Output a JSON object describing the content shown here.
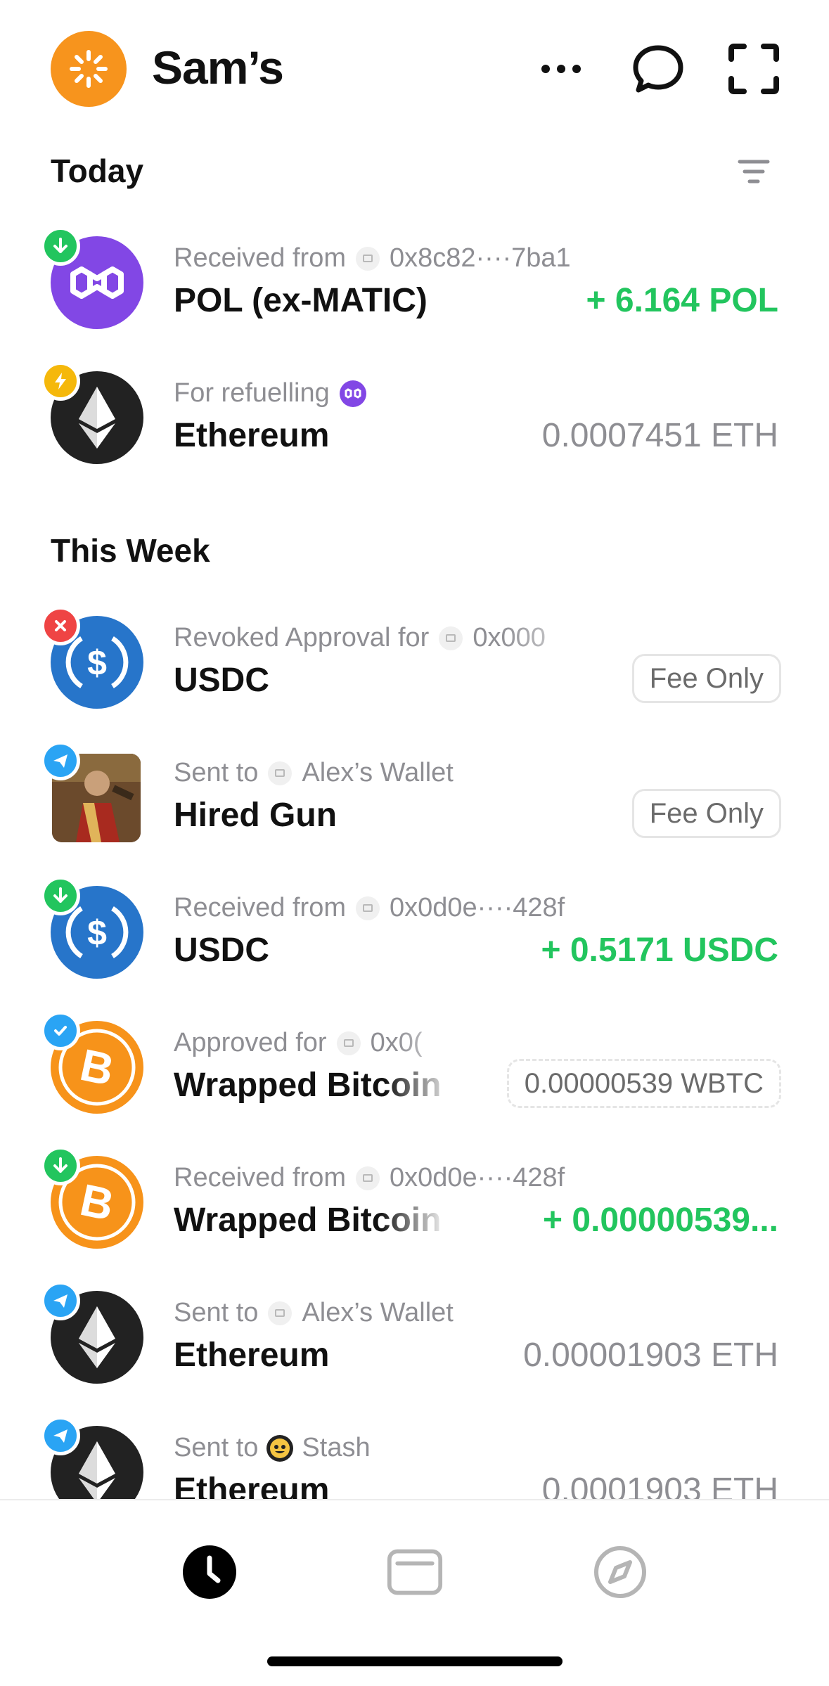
{
  "header": {
    "title": "Sam’s"
  },
  "sections": {
    "today": "Today",
    "this_week": "This Week"
  },
  "rows": [
    {
      "sub_label": "Received from",
      "sub_target": "0x8c82····7ba1",
      "name": "POL (ex-MATIC)",
      "amount": "+ 6.164 POL",
      "badge": "received-icon",
      "coin": "polygon-icon"
    },
    {
      "sub_label": "For refuelling",
      "sub_target": "",
      "name": "Ethereum",
      "amount": "0.0007451 ETH",
      "badge": "refuel-icon",
      "coin": "ethereum-icon"
    },
    {
      "sub_label": "Revoked Approval for",
      "sub_target": "0x000",
      "name": "USDC",
      "amount": "Fee Only",
      "badge": "revoked-icon",
      "coin": "usdc-icon"
    },
    {
      "sub_label": "Sent to",
      "sub_target": "Alex’s Wallet",
      "name": "Hired Gun",
      "amount": "Fee Only",
      "badge": "sent-icon",
      "coin": "nft-thumbnail"
    },
    {
      "sub_label": "Received from",
      "sub_target": "0x0d0e····428f",
      "name": "USDC",
      "amount": "+ 0.5171 USDC",
      "badge": "received-icon",
      "coin": "usdc-icon"
    },
    {
      "sub_label": "Approved for",
      "sub_target": "0x0(",
      "name": "Wrapped Bitcoin",
      "amount": "0.00000539 WBTC",
      "badge": "approved-icon",
      "coin": "bitcoin-icon"
    },
    {
      "sub_label": "Received from",
      "sub_target": "0x0d0e····428f",
      "name": "Wrapped Bitcoin",
      "amount": "+ 0.00000539...",
      "badge": "received-icon",
      "coin": "bitcoin-icon"
    },
    {
      "sub_label": "Sent to",
      "sub_target": "Alex’s Wallet",
      "name": "Ethereum",
      "amount": "0.00001903 ETH",
      "badge": "sent-icon",
      "coin": "ethereum-icon"
    },
    {
      "sub_label": "Sent to",
      "sub_target": "Stash",
      "name": "Ethereum",
      "amount": "0.0001903 ETH",
      "badge": "sent-icon",
      "coin": "ethereum-icon"
    }
  ],
  "tabs": [
    {
      "name": "activity-tab",
      "icon": "clock-icon",
      "active": true
    },
    {
      "name": "wallet-tab",
      "icon": "wallet-icon",
      "active": false
    },
    {
      "name": "explore-tab",
      "icon": "compass-icon",
      "active": false
    }
  ],
  "colors": {
    "accent": "#f7941d",
    "positive": "#22c55e",
    "muted": "#8e8e93",
    "polygon": "#8247e5",
    "usdc": "#2775ca",
    "bitcoin": "#f7931a",
    "ethereum": "#222222"
  }
}
